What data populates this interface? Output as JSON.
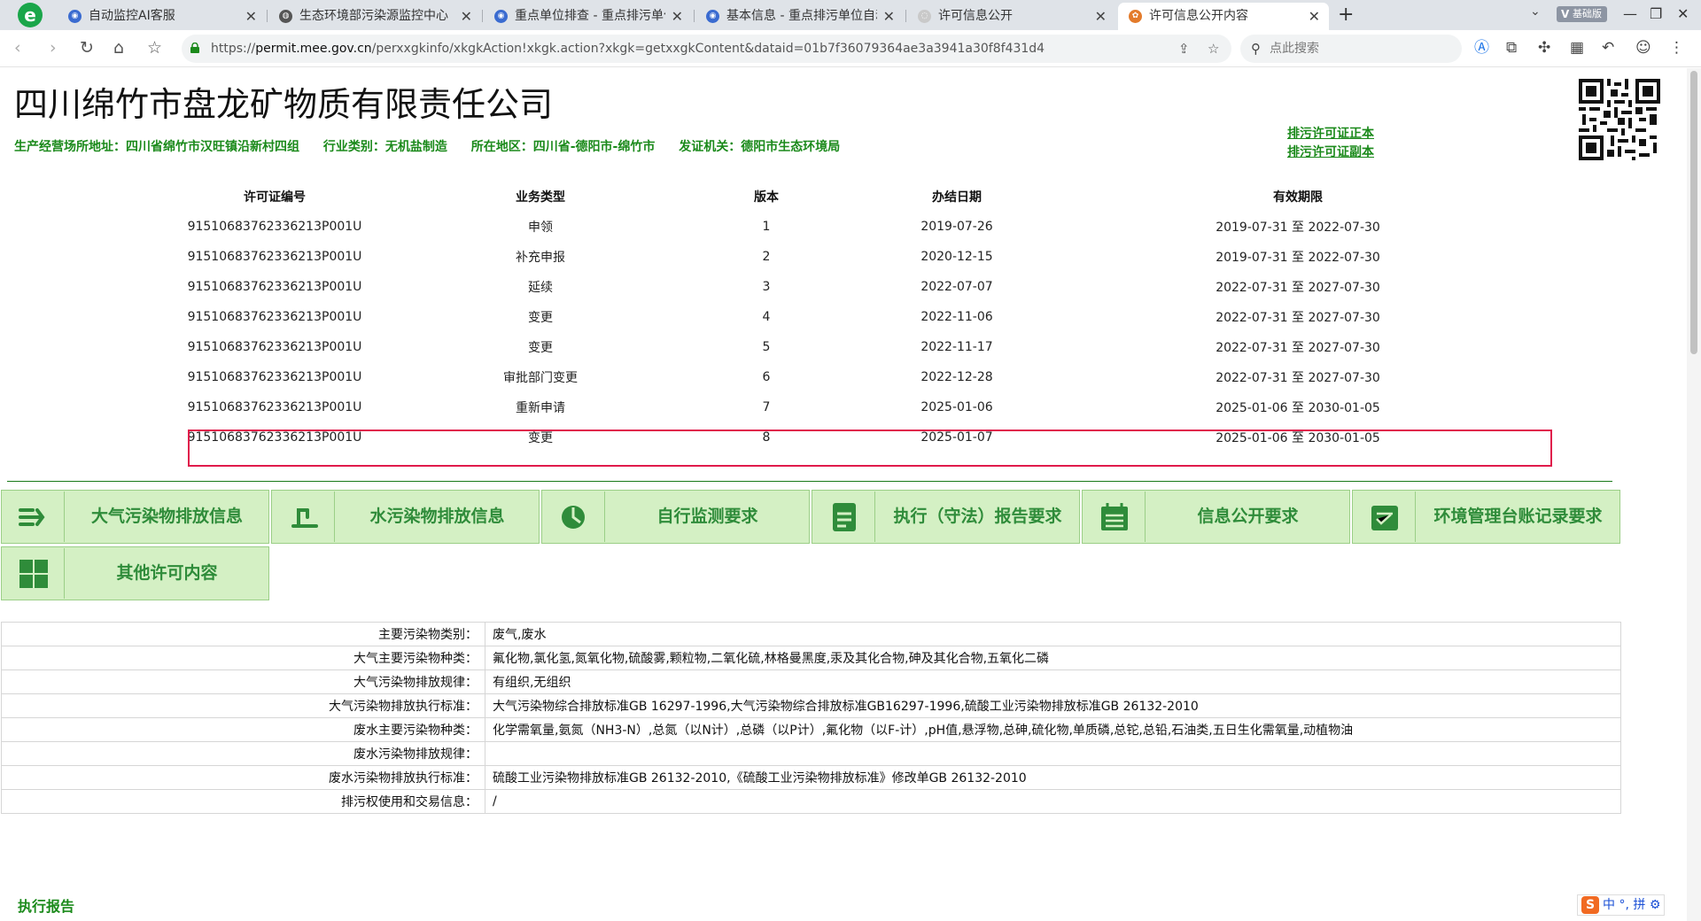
{
  "browser": {
    "tabs": [
      {
        "title": "自动监控AI客服",
        "active": false
      },
      {
        "title": "生态环境部污染源监控中心",
        "active": false
      },
      {
        "title": "重点单位排查 - 重点排污单位",
        "active": false
      },
      {
        "title": "基本信息 - 重点排污单位自动",
        "active": false
      },
      {
        "title": "许可信息公开",
        "active": false
      },
      {
        "title": "许可信息公开内容",
        "active": true
      }
    ],
    "edition_badge": "基础版",
    "url_prefix": "https://",
    "url_host": "permit.mee.gov.cn",
    "url_path": "/perxxgkinfo/xkgkAction!xkgk.action?xkgk=getxxgkContent&dataid=01b7f36079364ae3a3941a30f8f431d4",
    "search_placeholder": "点此搜索"
  },
  "company": {
    "name": "四川绵竹市盘龙矿物质有限责任公司",
    "address": "生产经营场所地址：四川省绵竹市汉旺镇沿新村四组",
    "industry": "行业类别：无机盐制造",
    "region": "所在地区：四川省-德阳市-绵竹市",
    "issuer": "发证机关：德阳市生态环境局",
    "link_original": "排污许可证正本",
    "link_copy": "排污许可证副本"
  },
  "permit_table": {
    "headers": [
      "许可证编号",
      "业务类型",
      "版本",
      "办结日期",
      "有效期限"
    ],
    "rows": [
      [
        "91510683762336213P001U",
        "申领",
        "1",
        "2019-07-26",
        "2019-07-31 至 2022-07-30"
      ],
      [
        "91510683762336213P001U",
        "补充申报",
        "2",
        "2020-12-15",
        "2019-07-31 至 2022-07-30"
      ],
      [
        "91510683762336213P001U",
        "延续",
        "3",
        "2022-07-07",
        "2022-07-31 至 2027-07-30"
      ],
      [
        "91510683762336213P001U",
        "变更",
        "4",
        "2022-11-06",
        "2022-07-31 至 2027-07-30"
      ],
      [
        "91510683762336213P001U",
        "变更",
        "5",
        "2022-11-17",
        "2022-07-31 至 2027-07-30"
      ],
      [
        "91510683762336213P001U",
        "审批部门变更",
        "6",
        "2022-12-28",
        "2022-07-31 至 2027-07-30"
      ],
      [
        "91510683762336213P001U",
        "重新申请",
        "7",
        "2025-01-06",
        "2025-01-06 至 2030-01-05"
      ],
      [
        "91510683762336213P001U",
        "变更",
        "8",
        "2025-01-07",
        "2025-01-06 至 2030-01-05"
      ]
    ]
  },
  "nav_buttons": [
    {
      "label": "大气污染物排放信息",
      "icon": "air-flow-icon"
    },
    {
      "label": "水污染物排放信息",
      "icon": "water-outlet-icon"
    },
    {
      "label": "自行监测要求",
      "icon": "monitor-dial-icon"
    },
    {
      "label": "执行（守法）报告要求",
      "icon": "report-doc-icon"
    },
    {
      "label": "信息公开要求",
      "icon": "calendar-icon"
    },
    {
      "label": "环境管理台账记录要求",
      "icon": "ledger-icon"
    },
    {
      "label": "其他许可内容",
      "icon": "grid-icon"
    }
  ],
  "details": [
    {
      "k": "主要污染物类别：",
      "v": "废气,废水"
    },
    {
      "k": "大气主要污染物种类：",
      "v": "氟化物,氯化氢,氮氧化物,硫酸雾,颗粒物,二氧化硫,林格曼黑度,汞及其化合物,砷及其化合物,五氧化二磷"
    },
    {
      "k": "大气污染物排放规律：",
      "v": "有组织,无组织"
    },
    {
      "k": "大气污染物排放执行标准：",
      "v": "大气污染物综合排放标准GB 16297-1996,大气污染物综合排放标准GB16297-1996,硫酸工业污染物排放标准GB 26132-2010"
    },
    {
      "k": "废水主要污染物种类：",
      "v": "化学需氧量,氨氮（NH3-N）,总氮（以N计）,总磷（以P计）,氟化物（以F-计）,pH值,悬浮物,总砷,硫化物,单质磷,总铊,总铅,石油类,五日生化需氧量,动植物油"
    },
    {
      "k": "废水污染物排放规律：",
      "v": ""
    },
    {
      "k": "废水污染物排放执行标准：",
      "v": "硫酸工业污染物排放标准GB 26132-2010,《硫酸工业污染物排放标准》修改单GB 26132-2010"
    },
    {
      "k": "排污权使用和交易信息：",
      "v": "/"
    }
  ],
  "section_title": "执行报告",
  "ime": {
    "lang": "中",
    "mode": "拼"
  }
}
